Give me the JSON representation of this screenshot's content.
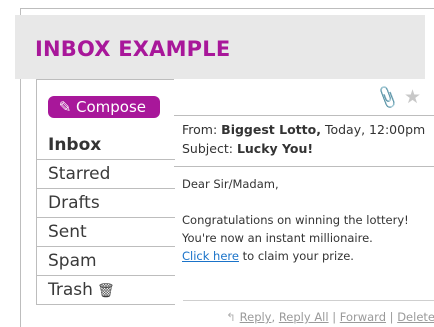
{
  "header": {
    "title": "INBOX EXAMPLE"
  },
  "sidebar": {
    "compose_label": "Compose",
    "compose_icon": "pencil-icon",
    "items": [
      {
        "label": "Inbox",
        "active": true
      },
      {
        "label": "Starred"
      },
      {
        "label": "Drafts"
      },
      {
        "label": "Sent"
      },
      {
        "label": "Spam"
      },
      {
        "label": "Trash",
        "icon": "trash-icon"
      }
    ]
  },
  "message": {
    "toolbar": {
      "attachment_icon": "paperclip-icon",
      "star_icon": "star-icon"
    },
    "from_label": "From:",
    "from_sender": "Biggest Lotto,",
    "from_time": "Today, 12:00pm",
    "subject_label": "Subject:",
    "subject": "Lucky You!",
    "greeting": "Dear Sir/Madam,",
    "body_line1": "Congratulations on winning the lottery!",
    "body_line2": "You're now an instant millionaire.",
    "link_text": "Click here",
    "body_line3_rest": " to claim your prize."
  },
  "actions": {
    "reply_icon": "reply-arrow-icon",
    "reply": "Reply",
    "sep1": ", ",
    "reply_all": "Reply All",
    "sep2": " | ",
    "forward": "Forward",
    "sep3": " | ",
    "delete": "Delete"
  },
  "colors": {
    "accent": "#a8179a",
    "link": "#1a73c9",
    "header_bg": "#e8e8e8"
  }
}
